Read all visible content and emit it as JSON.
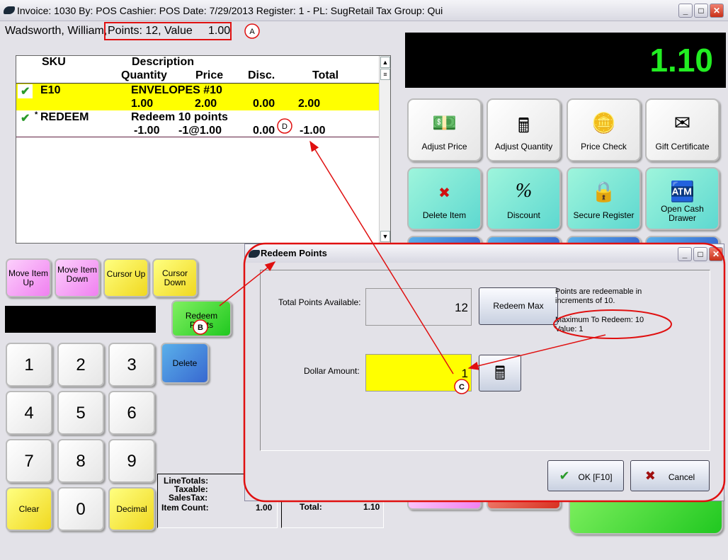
{
  "window": {
    "title": "Invoice: 1030  By: POS  Cashier: POS   Date:  7/29/2013  Register: 1 - PL: SugRetail  Tax Group: Qui",
    "minimize": "_",
    "maximize": "□",
    "close": "✕"
  },
  "customer": {
    "name": "Wadsworth, William,",
    "points": "Points: 12, Value     1.00"
  },
  "grid": {
    "headers": {
      "sku": "SKU",
      "description": "Description",
      "quantity": "Quantity",
      "price": "Price",
      "disc": "Disc.",
      "total": "Total"
    },
    "rows": [
      {
        "check": "✔",
        "sku": "E10",
        "description": "ENVELOPES #10",
        "quantity": "1.00",
        "price": "2.00",
        "disc": "0.00",
        "total": "2.00",
        "highlight": "#ffff00"
      },
      {
        "check": "✔",
        "mark": "*",
        "sku": "REDEEM",
        "description": "Redeem 10 points",
        "quantity": "-1.00",
        "price": "-1@1.00",
        "disc": "0.00",
        "total": "-1.00"
      }
    ]
  },
  "display": {
    "amount": "1.10"
  },
  "actions": [
    {
      "label": "Adjust Price",
      "icon": "money-icon"
    },
    {
      "label": "Adjust Quantity",
      "icon": "calculator-icon"
    },
    {
      "label": "Price Check",
      "icon": "coin-icon"
    },
    {
      "label": "Gift Certificate",
      "icon": "envelope-hand-icon"
    },
    {
      "label": "Delete Item",
      "icon": "x-icon",
      "glyph": "✖"
    },
    {
      "label": "Discount",
      "icon": "percent-icon",
      "glyph": "%"
    },
    {
      "label": "Secure Register",
      "icon": "lock-icon",
      "glyph": "🔒"
    },
    {
      "label": "Open Cash Drawer",
      "icon": "cash-register-icon"
    }
  ],
  "left_buttons": {
    "move_up": "Move Item Up",
    "move_down": "Move Item Down",
    "cursor_up": "Cursor Up",
    "cursor_down": "Cursor Down",
    "redeem": "Redeem Points",
    "delete": "Delete"
  },
  "keypad": [
    "1",
    "2",
    "3",
    "4",
    "5",
    "6",
    "7",
    "8",
    "9",
    "Clear",
    "0",
    "Decimal"
  ],
  "totals": {
    "line_totals": "LineTotals:",
    "taxable": "Taxable:",
    "sales_tax": "SalesTax:",
    "item_count_label": "Item Count:",
    "item_count": "1.00",
    "total_label": "Total:",
    "total": "1.10"
  },
  "dialog": {
    "title": "Redeem Points",
    "total_points_label": "Total Points Available:",
    "total_points": "12",
    "redeem_max": "Redeem Max",
    "info": "Points are redeemable in increments of 10.",
    "max_redeem": "Maximum To Redeem: 10",
    "value": "Value: 1",
    "dollar_label": "Dollar Amount:",
    "dollar_value": "1",
    "ok": "OK [F10]",
    "cancel": "Cancel"
  },
  "annotations": {
    "a": "A",
    "b": "B",
    "c": "C",
    "d": "D",
    "color": "#e01010"
  }
}
